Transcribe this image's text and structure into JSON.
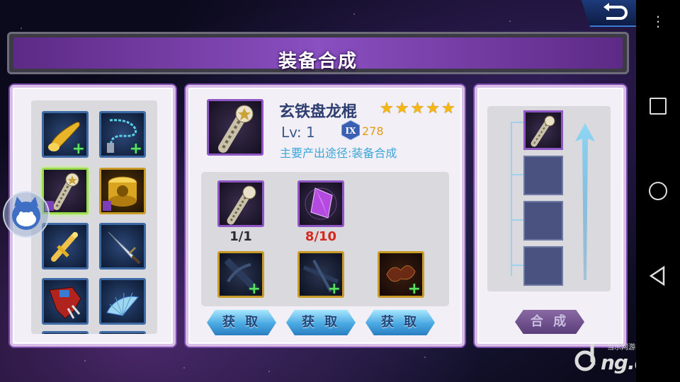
{
  "header": {
    "title": "装备合成",
    "back_icon": "return-arrow-icon"
  },
  "inventory": {
    "items": [
      {
        "name": "golden-horn",
        "frame": "blue",
        "has_plus": true
      },
      {
        "name": "chain-whip",
        "frame": "blue",
        "has_plus": true
      },
      {
        "name": "dragon-staff",
        "frame": "purple-selected",
        "has_plus": false
      },
      {
        "name": "golden-cylinder",
        "frame": "gold",
        "has_plus": false
      },
      {
        "name": "golden-sword",
        "frame": "blue",
        "has_plus": false
      },
      {
        "name": "dagger",
        "frame": "blue",
        "has_plus": false
      },
      {
        "name": "claw-gauntlet",
        "frame": "blue",
        "has_plus": false
      },
      {
        "name": "folding-fan",
        "frame": "blue",
        "has_plus": false
      }
    ]
  },
  "detail": {
    "item_name": "玄铁盘龙棍",
    "stars": 5,
    "level_label": "Lv: 1",
    "rank_badge": "IX",
    "power": "278",
    "source": "主要产出途径:装备合成"
  },
  "materials": {
    "top": [
      {
        "name": "dragon-staff",
        "count": "1/1",
        "count_color": "#2b2b2b"
      },
      {
        "name": "purple-crystal",
        "count": "8/10",
        "count_color": "#d42a1e"
      }
    ],
    "bottom": [
      {
        "name": "dark-blade-fragment-1",
        "has_plus": true
      },
      {
        "name": "dark-blade-fragment-2",
        "has_plus": true
      },
      {
        "name": "flame-cloud-fragment",
        "has_plus": true
      }
    ],
    "get_buttons": [
      "获 取",
      "获 取",
      "获 取"
    ]
  },
  "chain": {
    "slots": 4,
    "craft_label": "合 成"
  },
  "watermark": {
    "top": "当乐网游门户",
    "main": "ng.d.cn"
  },
  "navbar": {
    "menu_icon": "⋮"
  },
  "colors": {
    "title_purple": "#8a4fc0",
    "gold_star": "#f5b710",
    "power_orange": "#e39a1b",
    "source_blue": "#3aa6d8",
    "count_red": "#d42a1e",
    "slot_blue": "#3d6aa5",
    "slot_gold": "#c89b26",
    "frame_purple": "#8e55c4"
  }
}
